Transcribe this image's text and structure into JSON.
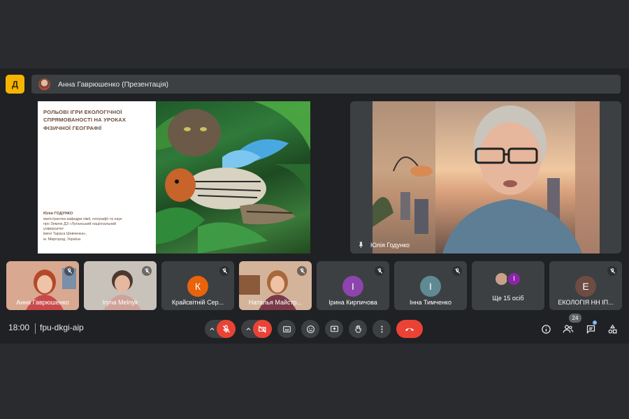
{
  "app": {
    "logo_letter": "Д",
    "accent_color": "#f4b400"
  },
  "presentation_bar": {
    "title": "Анна Гаврюшенко (Презентація)"
  },
  "slide": {
    "title_lines": [
      "РОЛЬОВІ ІГРИ ЕКОЛОГІЧНОЇ",
      "СПРЯМОВАНОСТІ НА УРОКАХ",
      "ФІЗИЧНОЇ ГЕОГРАФІЇ"
    ],
    "author_name": "Юлія ГОДУНКО",
    "author_lines": [
      "магістрантка кафедри хімії, географії та наук",
      "про Землю ДЗ «Луганський національний",
      "університет",
      "імені Тараса Шевченка»,",
      "м. Миргород, Україна"
    ]
  },
  "speaker": {
    "name": "Юлія Годунко",
    "pin_icon": "pin-icon"
  },
  "participants": [
    {
      "name": "Анна Гаврюшенко",
      "type": "video",
      "muted": true
    },
    {
      "name": "Iryna Melnyk",
      "type": "video",
      "muted": true
    },
    {
      "name": "Крайсвітній Сер...",
      "type": "avatar",
      "letter": "К",
      "color": "#e8630a",
      "muted": true
    },
    {
      "name": "Наталья Майстр...",
      "type": "video",
      "muted": true
    },
    {
      "name": "Ірина Кирпичова",
      "type": "avatar",
      "letter": "І",
      "color": "#8e44ad",
      "muted": true
    },
    {
      "name": "Інна Тимченко",
      "type": "avatar",
      "letter": "І",
      "color": "#5f8a94",
      "muted": true
    },
    {
      "name": "Ще 15 осіб",
      "type": "group",
      "letter": "І",
      "color": "#8e24aa"
    },
    {
      "name": "ЕКОЛОГІЯ НН ІП...",
      "type": "avatar",
      "letter": "Е",
      "color": "#6d4c41",
      "muted": true
    }
  ],
  "bottom": {
    "time": "18:00",
    "meeting_code": "fpu-dkgi-aip",
    "controls": [
      "mic-off-icon",
      "camera-off-icon",
      "captions-icon",
      "emoji-icon",
      "present-icon",
      "raise-hand-icon",
      "more-options-icon",
      "leave-call-icon"
    ],
    "right_icons": [
      "info-icon",
      "people-icon",
      "chat-icon",
      "activities-icon"
    ],
    "people_count": "24"
  },
  "colors": {
    "background": "#202124",
    "tile": "#3c4043",
    "danger": "#ea4335"
  }
}
